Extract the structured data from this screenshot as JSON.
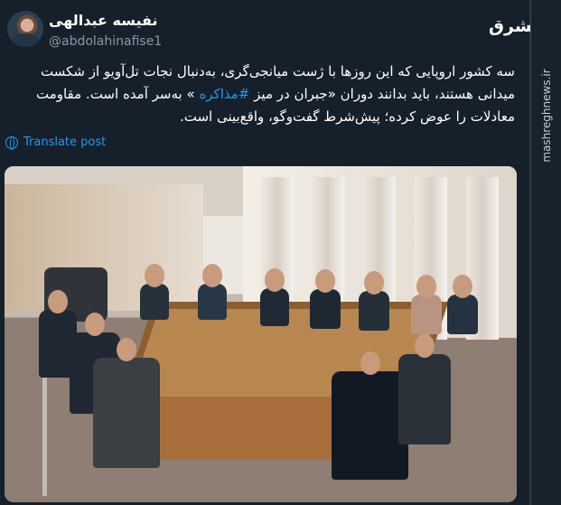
{
  "post": {
    "author_name": "نفیسه عبدالهی",
    "author_handle": "@abdolahinafise1",
    "text_before": "سه کشور اروپایی که این روزها با ژست میانجی‌گری، به‌دنبال نجات تل‌آویو از شکست میدانی هستند، باید بدانند دوران «جبران در میز",
    "hashtag": "#مذاکره",
    "text_after": "» به‌سر آمده است. مقاومت معادلات را عوض کرده؛ پیش‌شرط گفت‌وگو، واقع‌بینی است.",
    "translate_label": "Translate post"
  },
  "sidebar": {
    "site": "mashreghnews.ir"
  },
  "logo": {
    "text": "مشرق"
  },
  "icons": {
    "avatar": "profile-photo",
    "globe": "globe-icon",
    "site_logo": "brand-logo",
    "photo": "meeting-photo"
  },
  "colors": {
    "background": "#15202b",
    "text": "#ffffff",
    "muted": "#8b98a5",
    "accent": "#1d9bf0"
  }
}
